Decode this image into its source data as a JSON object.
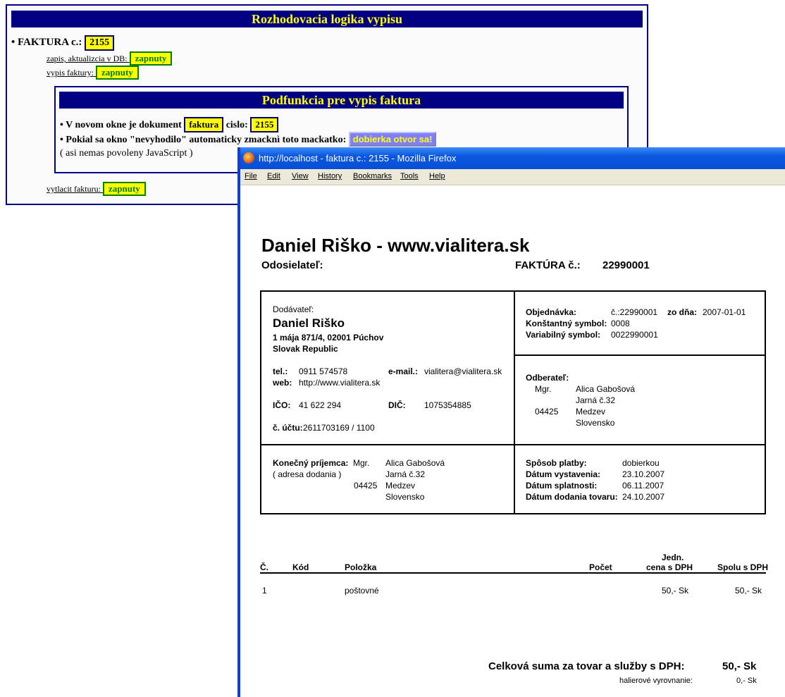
{
  "back_panel": {
    "title": "Rozhodovacia logika vypisu",
    "faktura_label": "• FAKTURA c.:",
    "faktura_number": "2155",
    "zapis_label": "zapis, aktualizcia v DB:",
    "zapis_state": "zapnuty",
    "vypis_label": "vypis faktury:",
    "vypis_state": "zapnuty",
    "sub": {
      "title": "Podfunkcia pre vypis faktura",
      "line1_prefix": "• V novom okne je dokument",
      "line1_doc": "faktura",
      "line1_mid": "cislo:",
      "line1_num": "2155",
      "line2_text": "• Pokial sa okno \"nevyhodilo\" automaticky zmacknì toto mackatko:",
      "line2_button": "dobierka otvor sa!",
      "line3": "( asi nemas povoleny JavaScript )"
    },
    "vytlacit_label": "vytlacit fakturu:",
    "vytlacit_state": "zapnuty"
  },
  "window": {
    "title": "http://localhost - faktura c.: 2155 - Mozilla Firefox",
    "menu": [
      "File",
      "Edit",
      "View",
      "History",
      "Bookmarks",
      "Tools",
      "Help"
    ]
  },
  "invoice": {
    "heading": "Daniel Riško - www.vialitera.sk",
    "sender_label": "Odosielateľ:",
    "invoice_label": "FAKTÚRA č.:",
    "invoice_number": "22990001",
    "supplier": {
      "label": "Dodávateľ:",
      "name": "Daniel Riško",
      "address1": "1 mája 871/4, 02001 Púchov",
      "address2": "Slovak Republic",
      "tel_label": "tel.:",
      "tel": "0911 574578",
      "email_label": "e-mail.:",
      "email": "vialitera@vialitera.sk",
      "web_label": "web:",
      "web": "http://www.vialitera.sk",
      "ico_label": "IČO:",
      "ico": "41 622 294",
      "dic_label": "DIČ:",
      "dic": "1075354885",
      "ucet_label": "č. účtu:",
      "ucet": "2611703169 / 1100"
    },
    "order": {
      "obj_label": "Objednávka:",
      "obj": "č.:22990001",
      "zo_dna_label": "zo dňa:",
      "zo_dna": "2007-01-01",
      "ks_label": "Konštantný symbol:",
      "ks": "0008",
      "vs_label": "Variabilný symbol:",
      "vs": "0022990001"
    },
    "customer": {
      "label": "Odberateľ:",
      "title": "Mgr.",
      "name": "Alica Gabošová",
      "street": "Jarná č.32",
      "zip": "04425",
      "city": "Medzev",
      "country": "Slovensko"
    },
    "recipient": {
      "label": "Konečný príjemca:",
      "note": "( adresa dodania )",
      "title": "Mgr.",
      "name": "Alica Gabošová",
      "street": "Jarná č.32",
      "zip": "04425",
      "city": "Medzev",
      "country": "Slovensko"
    },
    "payment": {
      "sposob_label": "Spôsob platby:",
      "sposob": "dobierkou",
      "vyst_label": "Dátum vystavenia:",
      "vyst": "23.10.2007",
      "splat_label": "Dátum splatnosti:",
      "splat": "06.11.2007",
      "dod_label": "Dátum dodania tovaru:",
      "dod": "24.10.2007"
    },
    "table": {
      "headers": [
        "Č.",
        "Kód",
        "Položka",
        "Počet",
        "Jedn.",
        "cena s DPH",
        "Spolu s DPH"
      ],
      "rows": [
        {
          "c": "1",
          "kod": "",
          "polozka": "poštovné",
          "pocet": "",
          "jedn": "50,- Sk",
          "spolu": "50,- Sk"
        }
      ]
    },
    "total_label": "Celková suma za tovar a služby s DPH:",
    "total": "50,- Sk",
    "rounding_label": "halierové vyrovnanie:",
    "rounding": "0,- Sk"
  }
}
